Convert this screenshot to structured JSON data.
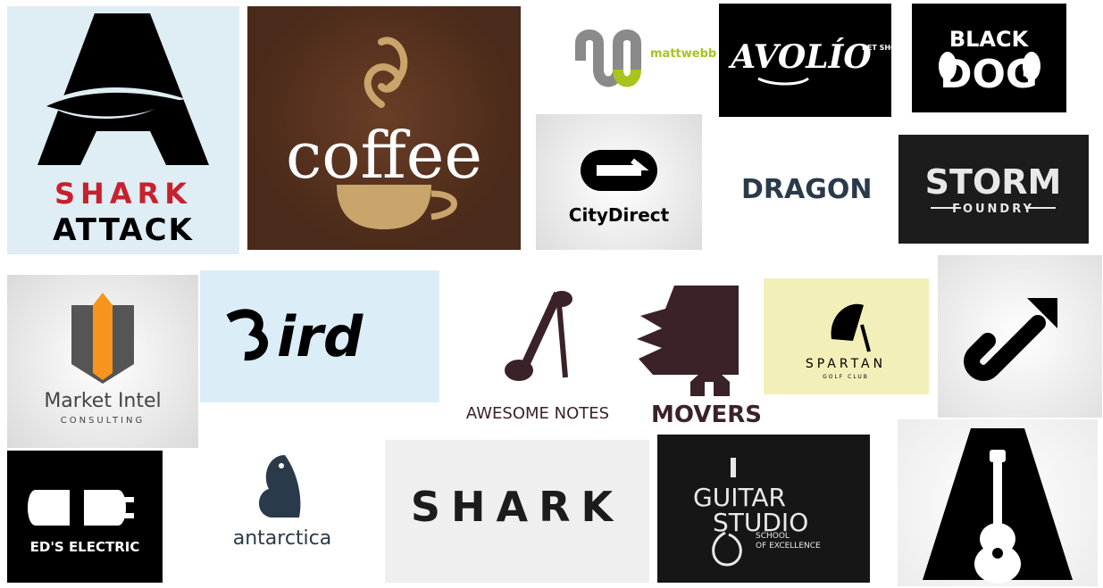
{
  "collage_title": "",
  "logos": {
    "shark_attack": {
      "line1": "SHARK",
      "line2": "ATTACK",
      "bg": "#dfedf4",
      "accent": "#c8202e"
    },
    "coffee": {
      "word": "coffee",
      "bg": "#4a2a1a",
      "accent": "#c9a46b"
    },
    "mattwebb": {
      "word": "mattwebb",
      "accent": "#a9c41c"
    },
    "avolio": {
      "word": "AVOLÍO",
      "sub": "PET SHOP"
    },
    "black_dog": {
      "line1": "BLACK",
      "line2": "DOG"
    },
    "city_direct": {
      "word": "CityDirect"
    },
    "dragon": {
      "word": "DRAGON"
    },
    "storm_foundry": {
      "line1": "STORM",
      "line2": "FOUNDRY"
    },
    "market_intel": {
      "line1": "Market Intel",
      "line2": "CONSULTING",
      "accent": "#f7941d"
    },
    "bird": {
      "word": "ird",
      "bg": "#dbeef8"
    },
    "awesome_notes": {
      "word": "AWESOME NOTES"
    },
    "movers": {
      "word": "MOVERS"
    },
    "spartan": {
      "line1": "SPARTAN",
      "line2": "GOLF CLUB",
      "bg": "#f3efb9"
    },
    "eds_electric": {
      "word": "ED'S ELECTRIC"
    },
    "antarctica": {
      "word": "antarctica"
    },
    "shark": {
      "word": "SHARK"
    },
    "guitar_studio": {
      "line1": "GUITAR",
      "line2": "STUDIO",
      "line3": "SCHOOL",
      "line4": "OF EXCELLENCE"
    }
  }
}
